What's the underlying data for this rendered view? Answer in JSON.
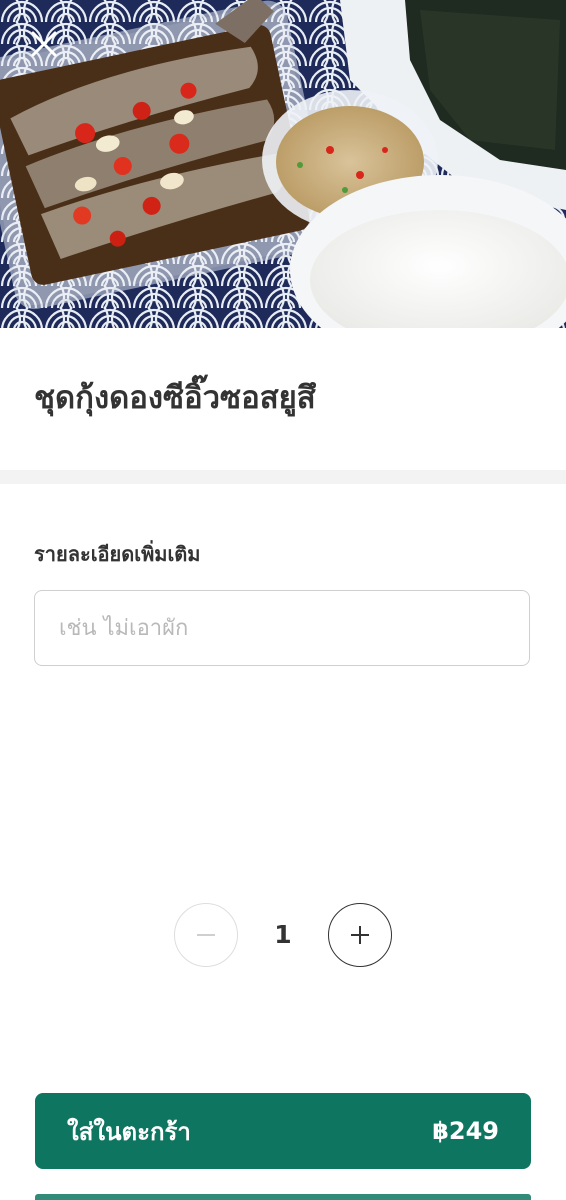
{
  "header": {
    "close_icon": "close-icon"
  },
  "product": {
    "title": "ชุดกุ้งดองซีอิ๊วซอสยูสึ"
  },
  "notes": {
    "label": "รายละเอียดเพิ่มเติม",
    "placeholder": "เช่น ไม่เอาผัก",
    "value": ""
  },
  "quantity": {
    "value": "1",
    "minus_icon": "minus-icon",
    "plus_icon": "plus-icon"
  },
  "cart": {
    "label": "ใส่ในตะกร้า",
    "price": "฿249"
  },
  "colors": {
    "accent": "#0e7560",
    "divider": "#f3f3f3",
    "pattern_navy": "#1d2a5a"
  }
}
